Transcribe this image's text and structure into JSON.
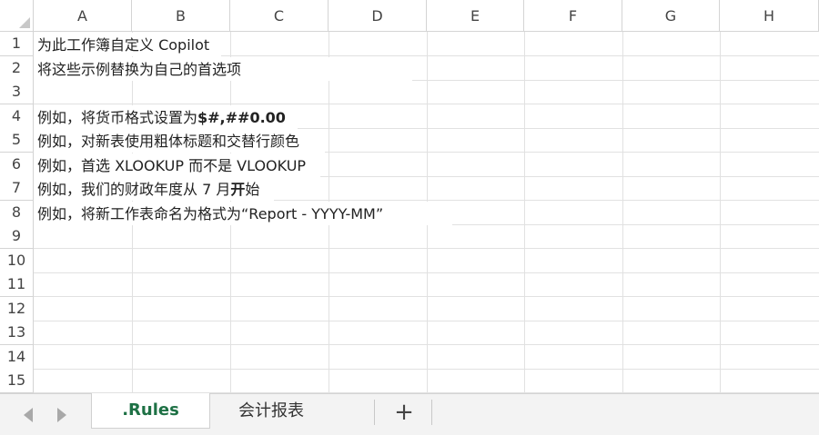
{
  "columns": [
    "A",
    "B",
    "C",
    "D",
    "E",
    "F",
    "G",
    "H"
  ],
  "rows": [
    "1",
    "2",
    "3",
    "4",
    "5",
    "6",
    "7",
    "8",
    "9",
    "10",
    "11",
    "12",
    "13",
    "14",
    "15"
  ],
  "cells": {
    "r1": "为此工作簿自定义 Copilot",
    "r2": "将这些示例替换为自己的首选项",
    "r4_prefix": "例如，将货币格式设置为",
    "r4_bold": "$#,##0.00",
    "r5": "例如，对新表使用粗体标题和交替行颜色",
    "r6": "例如，首选 XLOOKUP 而不是 VLOOKUP",
    "r7_prefix": "例如，我们的财政年度从 7 月",
    "r7_bold": "开",
    "r7_suffix": "始",
    "r8": "例如，将新工作表命名为格式为“Report - YYYY-MM”"
  },
  "tabs": {
    "prev_icon": "triangle-left-icon",
    "next_icon": "triangle-right-icon",
    "sheets": [
      {
        "label": ".Rules",
        "active": true
      },
      {
        "label": "会计报表",
        "active": false
      }
    ],
    "add_label": "+"
  },
  "colors": {
    "active_tab_text": "#1e7145",
    "gridline": "#e1e1e1",
    "header_border": "#d4d4d4",
    "tabbar_bg": "#f3f3f3"
  }
}
